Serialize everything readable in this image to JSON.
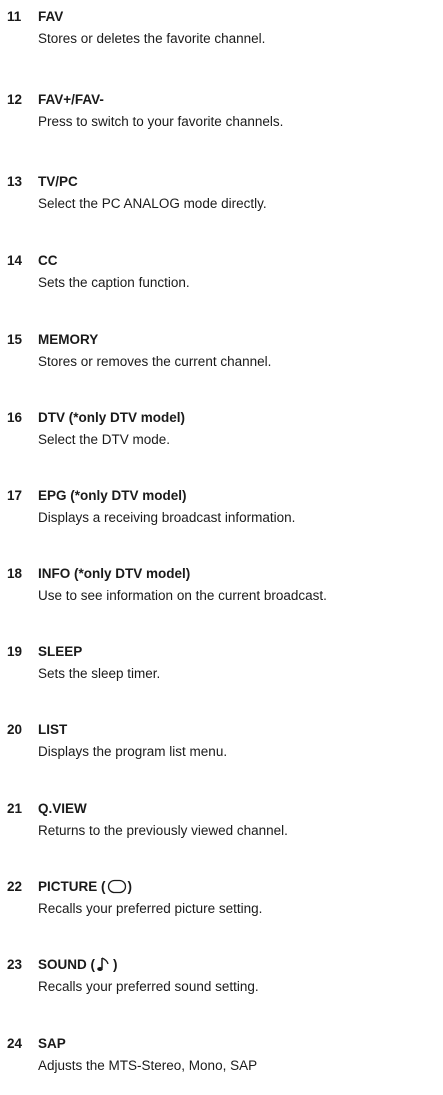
{
  "items": [
    {
      "num": "11",
      "title": "FAV",
      "desc": "Stores or deletes the favorite channel."
    },
    {
      "num": "12",
      "title": "FAV+/FAV-",
      "desc": "Press to switch to your favorite channels."
    },
    {
      "num": "13",
      "title": "TV/PC",
      "desc": "Select the PC ANALOG mode directly."
    },
    {
      "num": "14",
      "title": "CC",
      "desc": "Sets the caption function."
    },
    {
      "num": "15",
      "title": "MEMORY",
      "desc": "Stores or removes the current channel."
    },
    {
      "num": "16",
      "title": "DTV (*only DTV model)",
      "desc": "Select the DTV mode."
    },
    {
      "num": "17",
      "title": "EPG (*only DTV model)",
      "desc": "Displays a receiving broadcast information."
    },
    {
      "num": "18",
      "title": "INFO (*only DTV model)",
      "desc": "Use to see information on the current broadcast."
    },
    {
      "num": "19",
      "title": "SLEEP",
      "desc": "Sets the sleep timer."
    },
    {
      "num": "20",
      "title": "LIST",
      "desc": "Displays the program list menu."
    },
    {
      "num": "21",
      "title": "Q.VIEW",
      "desc": "Returns to the previously viewed channel."
    },
    {
      "num": "22",
      "title_pre": "PICTURE (",
      "title_post": ")",
      "icon": "picture-icon",
      "desc": "Recalls your preferred picture setting."
    },
    {
      "num": "23",
      "title_pre": "SOUND (",
      "title_post": ")",
      "icon": "music-note-icon",
      "desc": "Recalls your preferred sound setting."
    },
    {
      "num": "24",
      "title": "SAP",
      "desc": "Adjusts the MTS-Stereo, Mono, SAP"
    }
  ]
}
